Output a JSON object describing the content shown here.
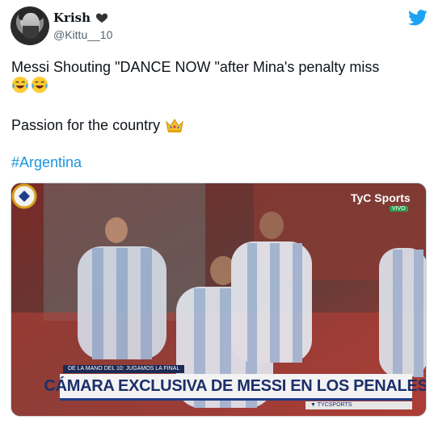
{
  "tweet": {
    "display_name": "Krish",
    "handle": "@Kittu__10",
    "icons": {
      "name_badge": "black-heart-icon",
      "brand": "twitter-bird-icon",
      "laugh": "face-with-tears-of-joy-icon",
      "crown": "crown-icon"
    },
    "text_line1": "Messi Shouting \"DANCE NOW \"after Mina's penalty miss",
    "text_line2": "Passion for the country",
    "hashtag": "#Argentina"
  },
  "media": {
    "broadcaster": "TyC Sports",
    "live_badge": "VIVO",
    "strip_text": "DE LA MANO DEL 10: JUGAMOS LA FINAL",
    "headline": "CÁMARA EXCLUSIVA DE MESSI EN LOS PENALES",
    "ticker": "▼ TYCSPORTS"
  },
  "colors": {
    "hashtag": "#1b95e0",
    "twitter_blue": "#1da1f2",
    "text": "#0f1419",
    "muted": "#536471"
  }
}
